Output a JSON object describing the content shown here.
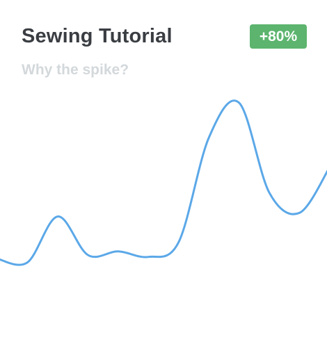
{
  "card": {
    "title": "Sewing Tutorial",
    "subtitle": "Why the spike?",
    "badge": "+80%"
  },
  "colors": {
    "badge_bg": "#5cb46e",
    "line": "#5ba8e8"
  },
  "chart_data": {
    "type": "line",
    "title": "",
    "xlabel": "",
    "ylabel": "",
    "grid": false,
    "legend": "none",
    "x": [
      0,
      1,
      2,
      3,
      4,
      5,
      6,
      7,
      8,
      9,
      10,
      11
    ],
    "series": [
      {
        "values": [
          12,
          10,
          35,
          14,
          16,
          13,
          21,
          78,
          97,
          48,
          37,
          62
        ]
      }
    ],
    "ylim": [
      0,
      100
    ]
  }
}
